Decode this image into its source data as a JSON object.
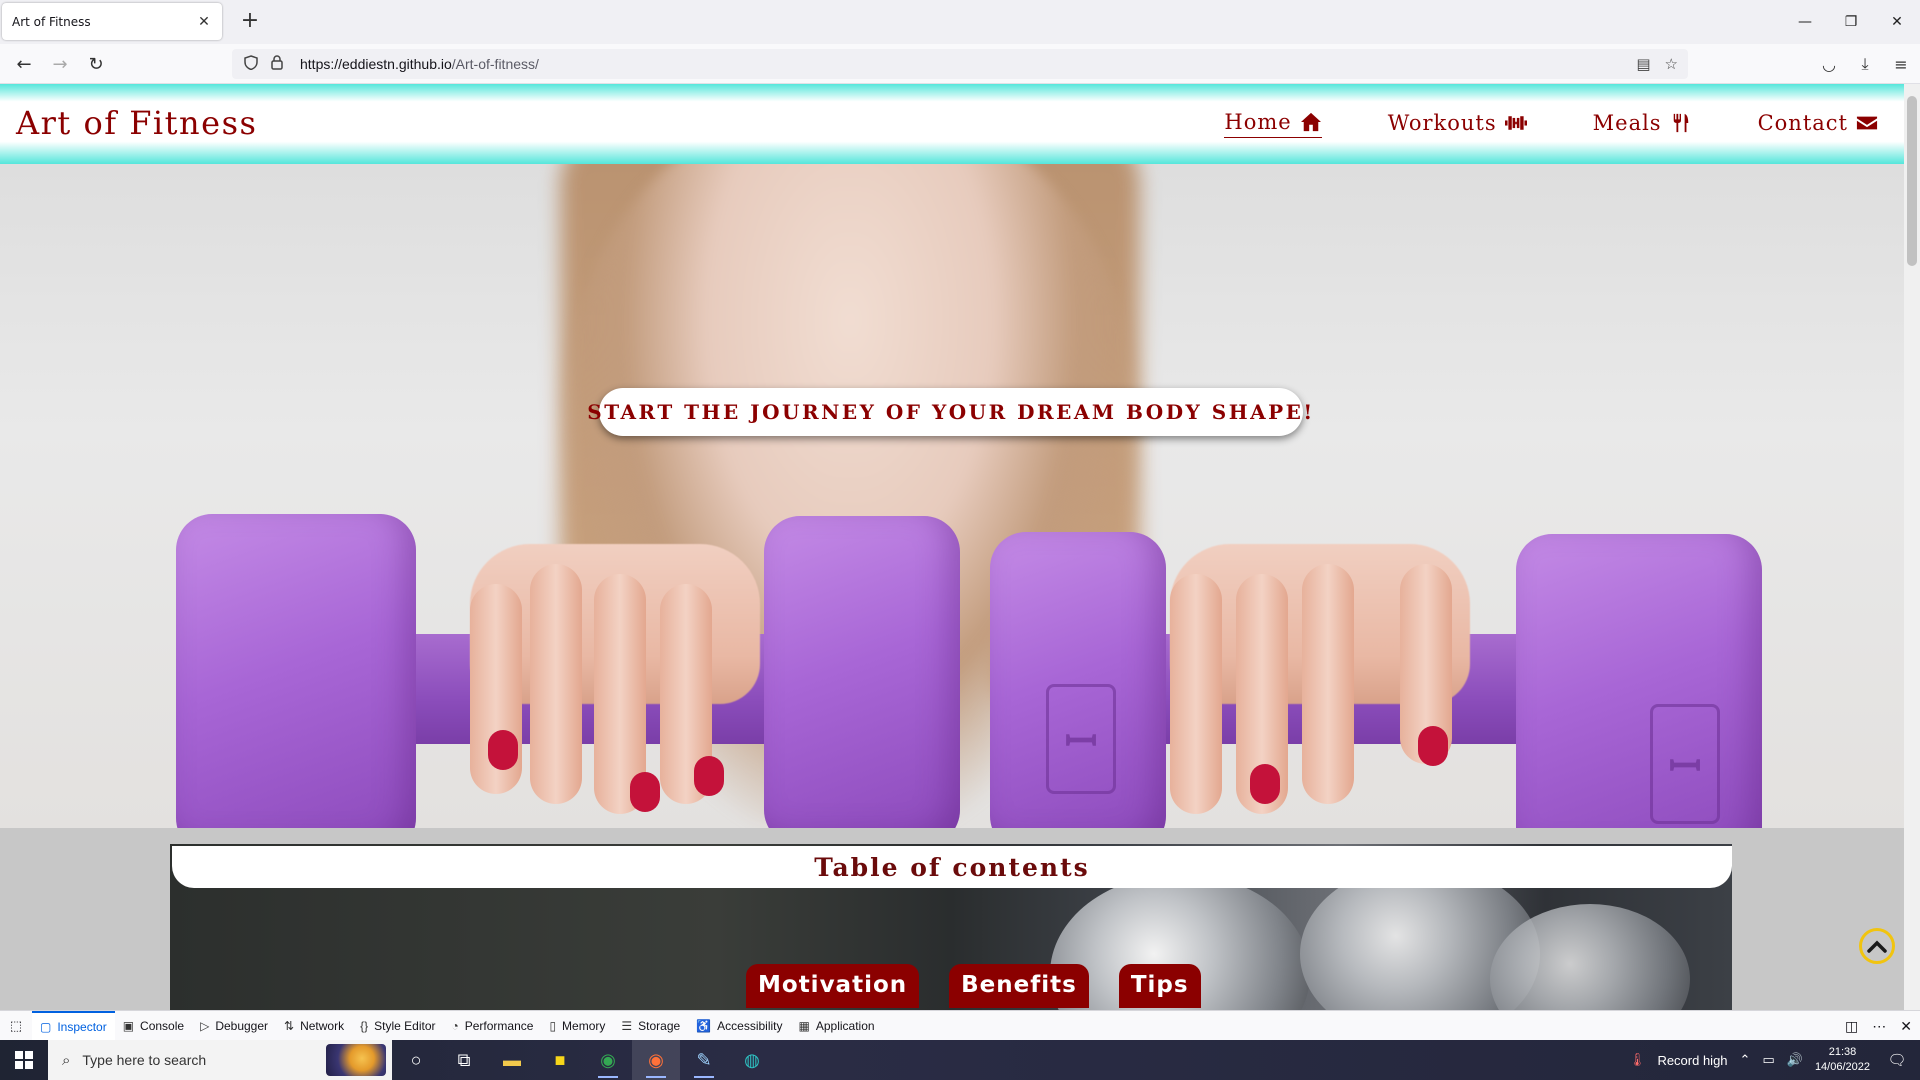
{
  "browser": {
    "tab_title": "Art of Fitness",
    "tab_close": "✕",
    "new_tab": "+",
    "window_controls": {
      "minimize": "—",
      "restore": "❐",
      "close": "✕"
    },
    "url_host": "https://eddiestn.github.io",
    "url_path": "/Art-of-fitness/"
  },
  "site": {
    "logo": "Art of Fitness",
    "nav": [
      {
        "label": "Home",
        "icon": "home-icon",
        "active": true
      },
      {
        "label": "Workouts",
        "icon": "dumbbell-icon",
        "active": false
      },
      {
        "label": "Meals",
        "icon": "utensils-icon",
        "active": false
      },
      {
        "label": "Contact",
        "icon": "envelope-icon",
        "active": false
      }
    ],
    "hero_tagline": "START THE JOURNEY OF YOUR DREAM BODY SHAPE!",
    "toc_title": "Table of contents",
    "toc_links": [
      "Motivation",
      "Benefits",
      "Tips"
    ],
    "colors": {
      "brand": "#8b0000",
      "header_accent": "#55e6db",
      "back_to_top": "#f1c40f"
    }
  },
  "devtools": {
    "tabs": [
      {
        "label": "Inspector",
        "icon": "inspector-icon",
        "active": true
      },
      {
        "label": "Console",
        "icon": "console-icon"
      },
      {
        "label": "Debugger",
        "icon": "debugger-icon"
      },
      {
        "label": "Network",
        "icon": "network-icon"
      },
      {
        "label": "Style Editor",
        "icon": "style-editor-icon"
      },
      {
        "label": "Performance",
        "icon": "performance-icon"
      },
      {
        "label": "Memory",
        "icon": "memory-icon"
      },
      {
        "label": "Storage",
        "icon": "storage-icon"
      },
      {
        "label": "Accessibility",
        "icon": "accessibility-icon"
      },
      {
        "label": "Application",
        "icon": "application-icon"
      }
    ]
  },
  "taskbar": {
    "search_placeholder": "Type here to search",
    "weather_text": "Record high",
    "time": "21:38",
    "date": "14/06/2022"
  }
}
